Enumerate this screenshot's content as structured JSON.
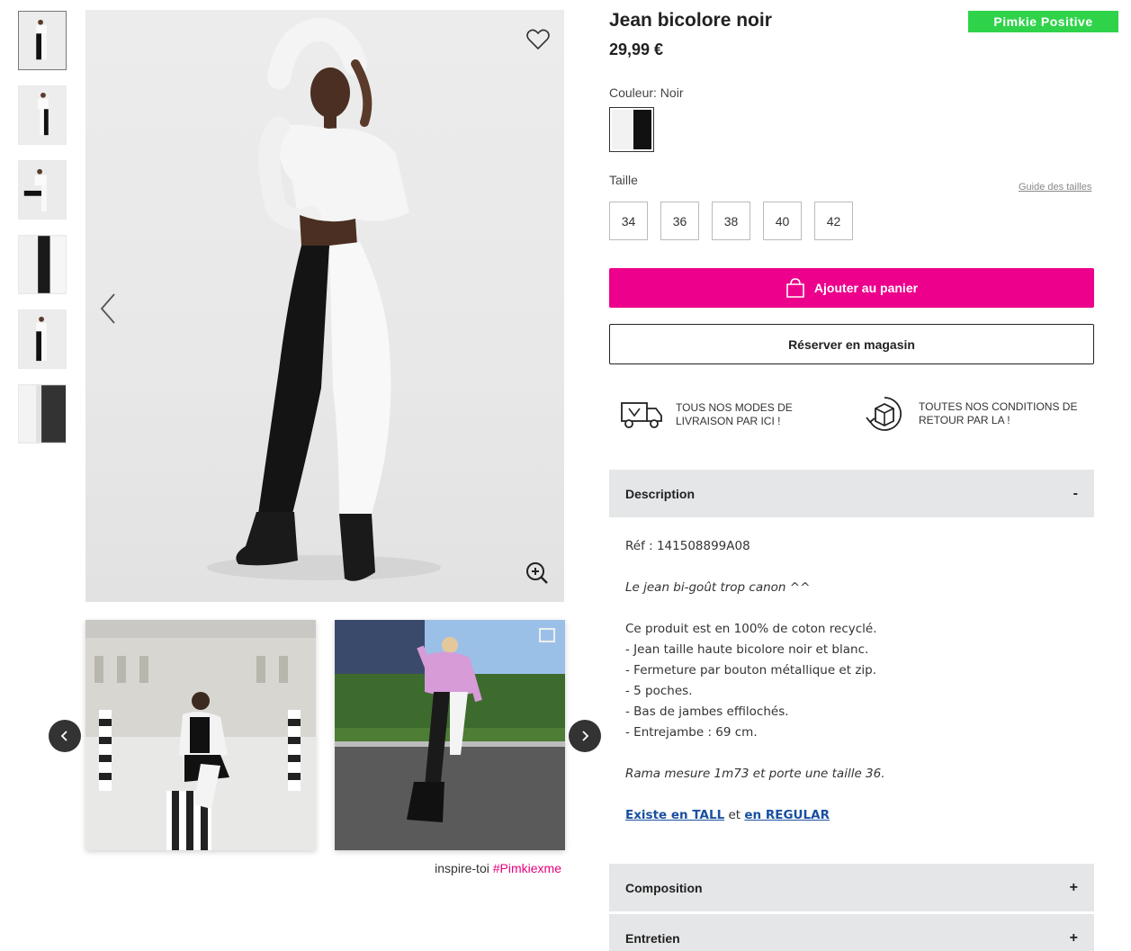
{
  "product": {
    "title": "Jean bicolore noir",
    "price": "29,99 €",
    "badge": "Pimkie Positive",
    "color_label": "Couleur: Noir",
    "size_label": "Taille",
    "size_guide": "Guide des tailles",
    "sizes": [
      "34",
      "36",
      "38",
      "40",
      "42"
    ]
  },
  "actions": {
    "add_to_cart": "Ajouter au panier",
    "reserve": "Réserver en magasin"
  },
  "info": {
    "delivery": "TOUS NOS MODES DE LIVRAISON PAR ICI !",
    "returns": "TOUTES NOS CONDITIONS DE RETOUR PAR LA !"
  },
  "accordion": {
    "description": "Description",
    "description_sign": "-",
    "composition": "Composition",
    "composition_sign": "+",
    "care": "Entretien",
    "care_sign": "+"
  },
  "description": {
    "ref": "Réf : 141508899A08",
    "tagline": "Le jean bi-goût trop canon ^^",
    "intro": "Ce produit est en 100% de coton recyclé.",
    "bullets": [
      "- Jean taille haute bicolore noir et blanc.",
      "- Fermeture par bouton métallique et zip.",
      "- 5 poches.",
      "- Bas de jambes effilochés.",
      "- Entrejambe : 69 cm."
    ],
    "model": "Rama mesure 1m73 et porte une taille 36.",
    "link_tall": "Existe en TALL",
    "link_and": "et",
    "link_regular": "en REGULAR"
  },
  "inspiration": {
    "prefix": "inspire-toi",
    "hashtag": "#Pimkiexme"
  },
  "colors": {
    "accent": "#ec008c",
    "badge": "#2fd34a",
    "link": "#1a4fa0",
    "accordion_bg": "#e5e6e7"
  }
}
